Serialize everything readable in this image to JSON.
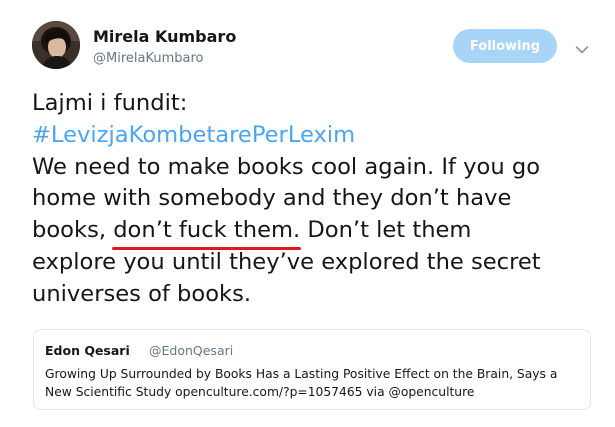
{
  "author": {
    "display_name": "Mirela Kumbaro",
    "handle": "@MirelaKumbaro",
    "avatar_icon": "profile-photo"
  },
  "follow_button": {
    "label": "Following",
    "color": "#a8d4f7"
  },
  "menu_caret_icon": "chevron-down-icon",
  "tweet": {
    "lines": [
      "Lajmi i fundit:",
      "#LevizjaKombetarePerLexim",
      "We need to make books cool again. If you go",
      "home with somebody and they don’t have",
      "books,",
      "don’t fuck them.",
      "Don’t let them",
      "explore you until they’ve explored the secret",
      "universes of books."
    ],
    "hashtag_color": "#4ba5f2",
    "underline_color": "#e0191e"
  },
  "quoted_tweet": {
    "display_name": "Edon Qesari",
    "handle": "@EdonQesari",
    "text_lines": [
      "Growing Up Surrounded by Books Has a Lasting Positive Effect on the Brain, Says a",
      "New Scientific Study openculture.com/?p=1057465 via @openculture"
    ]
  }
}
